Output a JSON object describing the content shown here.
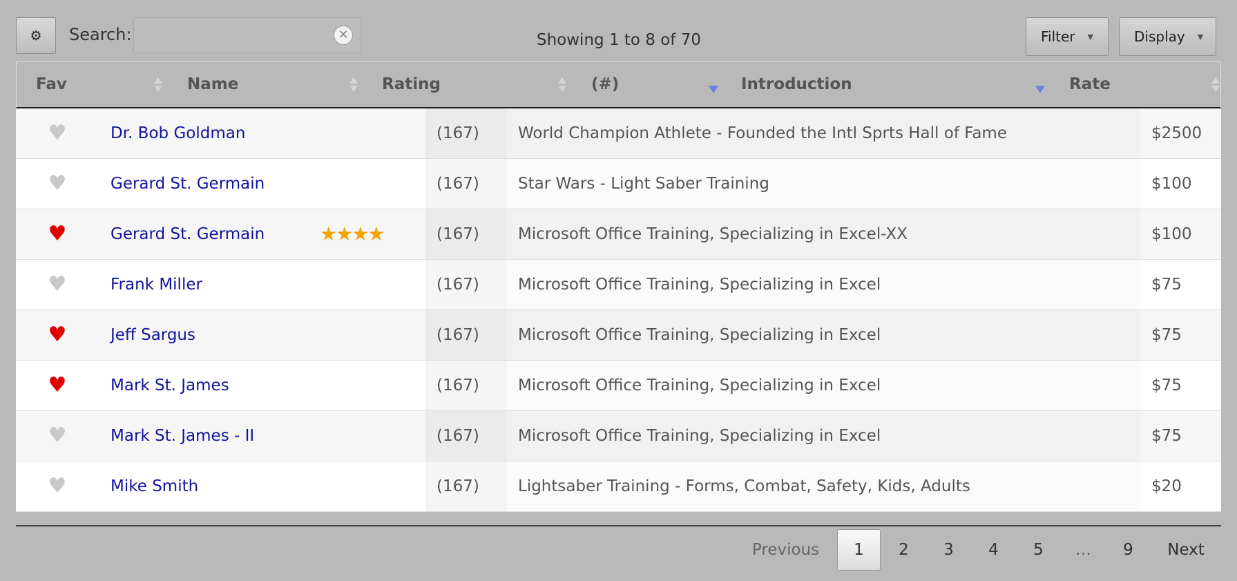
{
  "toolbar": {
    "gear_icon": "gear-icon",
    "search_label": "Search:",
    "search_value": "",
    "search_placeholder": "",
    "clear_glyph": "✕",
    "showing_text": "Showing 1 to 8 of 70",
    "filter_label": "Filter",
    "display_label": "Display",
    "caret": "▼"
  },
  "table": {
    "columns": [
      {
        "label": "Fav",
        "sort": "none"
      },
      {
        "label": "Name",
        "sort": "none"
      },
      {
        "label": "Rating",
        "sort": "none"
      },
      {
        "label": "(#)",
        "sort": "desc"
      },
      {
        "label": "Introduction",
        "sort": "desc"
      },
      {
        "label": "Rate",
        "sort": "none"
      }
    ],
    "rows": [
      {
        "fav": "♥",
        "fav_on": false,
        "name": "Dr. Bob Goldman",
        "stars": "",
        "count": "(167)",
        "intro": "World Champion Athlete - Founded the Intl Sprts Hall of Fame",
        "rate": "$2500"
      },
      {
        "fav": "♥",
        "fav_on": false,
        "name": "Gerard St. Germain",
        "stars": "",
        "count": "(167)",
        "intro": "Star Wars - Light Saber Training",
        "rate": "$100"
      },
      {
        "fav": "♥",
        "fav_on": true,
        "name": "Gerard St. Germain",
        "stars": "★★★★",
        "count": "(167)",
        "intro": "Microsoft Office Training, Specializing in Excel-XX",
        "rate": "$100"
      },
      {
        "fav": "♥",
        "fav_on": false,
        "name": "Frank Miller",
        "stars": "",
        "count": "(167)",
        "intro": "Microsoft Office Training, Specializing in Excel",
        "rate": "$75"
      },
      {
        "fav": "♥",
        "fav_on": true,
        "name": "Jeff Sargus",
        "stars": "",
        "count": "(167)",
        "intro": "Microsoft Office Training, Specializing in Excel",
        "rate": "$75"
      },
      {
        "fav": "♥",
        "fav_on": true,
        "name": "Mark St. James",
        "stars": "",
        "count": "(167)",
        "intro": "Microsoft Office Training, Specializing in Excel",
        "rate": "$75"
      },
      {
        "fav": "♥",
        "fav_on": false,
        "name": "Mark St. James - II",
        "stars": "",
        "count": "(167)",
        "intro": "Microsoft Office Training, Specializing in Excel",
        "rate": "$75"
      },
      {
        "fav": "♥",
        "fav_on": false,
        "name": "Mike Smith",
        "stars": "",
        "count": "(167)",
        "intro": "Lightsaber Training - Forms, Combat, Safety, Kids, Adults",
        "rate": "$20"
      }
    ]
  },
  "pagination": {
    "previous": "Previous",
    "pages": [
      "1",
      "2",
      "3",
      "4",
      "5",
      "…",
      "9"
    ],
    "current": "1",
    "next": "Next"
  },
  "colors": {
    "background": "#b9b9b9",
    "link": "#10149c",
    "heart_on": "#e00000",
    "heart_off": "#c8c8c8",
    "star": "#f5a300",
    "sort_active": "#6f7fe0"
  }
}
